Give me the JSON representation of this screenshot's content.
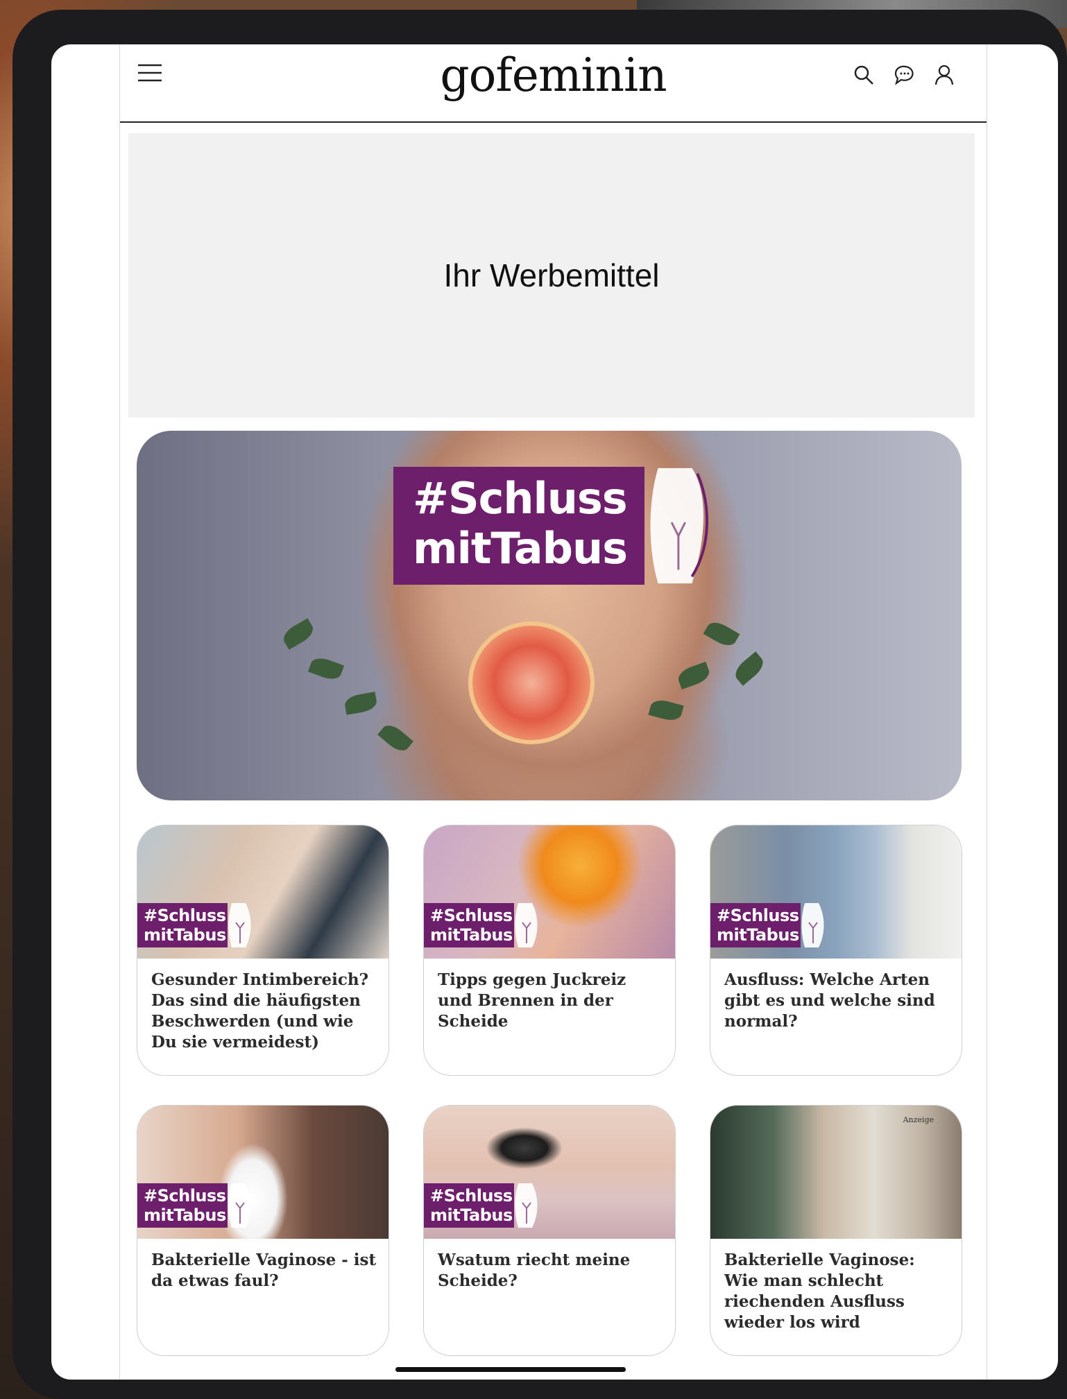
{
  "header": {
    "logo": "gofeminin",
    "icons": [
      "menu-icon",
      "search-icon",
      "chat-icon",
      "user-icon"
    ]
  },
  "ad": {
    "label": "Ihr Werbemittel"
  },
  "hero": {
    "tag_line1": "#Schluss",
    "tag_line2": "mitTabus"
  },
  "cards": [
    {
      "tag1": "#Schluss",
      "tag2": "mitTabus",
      "title": "Gesunder Intimbereich? Das sind die häufigsten Beschwerden (und wie Du sie vermeidest)"
    },
    {
      "tag1": "#Schluss",
      "tag2": "mitTabus",
      "title": "Tipps gegen Juckreiz und Brennen in der Scheide"
    },
    {
      "tag1": "#Schluss",
      "tag2": "mitTabus",
      "title": "Ausfluss: Welche Arten gibt es und welche sind normal?"
    },
    {
      "tag1": "#Schluss",
      "tag2": "mitTabus",
      "title": "Bakterielle Vaginose - ist da etwas faul?"
    },
    {
      "tag1": "#Schluss",
      "tag2": "mitTabus",
      "title": "Wsatum riecht meine Scheide?"
    },
    {
      "badge": "Anzeige",
      "title": "Bakterielle Vaginose: Wie man schlecht riechenden Ausfluss wieder los wird"
    }
  ],
  "colors": {
    "tag_purple": "#6e1f6c",
    "text": "#2b2b2b"
  }
}
